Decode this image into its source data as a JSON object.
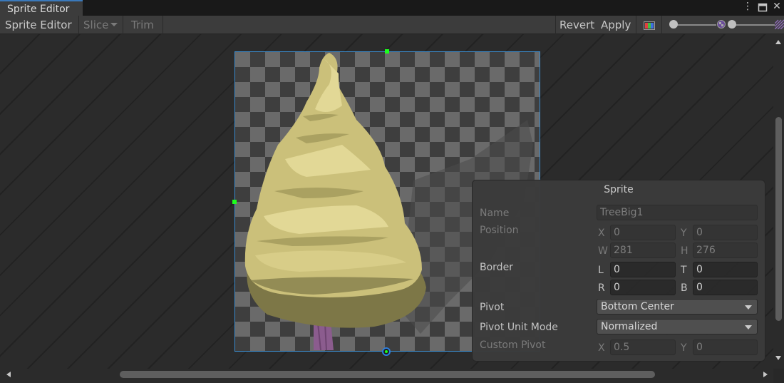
{
  "window": {
    "tab_title": "Sprite Editor",
    "menu_icon": "kebab-menu-icon",
    "maximize_icon": "maximize-icon",
    "close_icon": "close-icon"
  },
  "toolbar": {
    "mode_label": "Sprite Editor",
    "slice_label": "Slice",
    "trim_label": "Trim",
    "revert_label": "Revert",
    "apply_label": "Apply",
    "color_toggle_icon": "color-channel-icon",
    "zoom_icon": "zoom-icon",
    "mip_icon": "mip-level-icon",
    "zoom_level": 0.0,
    "mip_level": 0.0
  },
  "sprite_panel": {
    "title": "Sprite",
    "name_label": "Name",
    "name_value": "TreeBig1",
    "position_label": "Position",
    "x_label": "X",
    "x_value": "0",
    "y_label": "Y",
    "y_value": "0",
    "w_label": "W",
    "w_value": "281",
    "h_label": "H",
    "h_value": "276",
    "border_label": "Border",
    "l_label": "L",
    "l_value": "0",
    "t_label": "T",
    "t_value": "0",
    "r_label": "R",
    "r_value": "0",
    "b_label": "B",
    "b_value": "0",
    "pivot_label": "Pivot",
    "pivot_value": "Bottom Center",
    "pivot_unit_label": "Pivot Unit Mode",
    "pivot_unit_value": "Normalized",
    "custom_pivot_label": "Custom Pivot",
    "cp_x_label": "X",
    "cp_x_value": "0.5",
    "cp_y_label": "Y",
    "cp_y_value": "0"
  },
  "colors": {
    "accent": "#3a8ccf",
    "handle": "#1cff1c"
  }
}
